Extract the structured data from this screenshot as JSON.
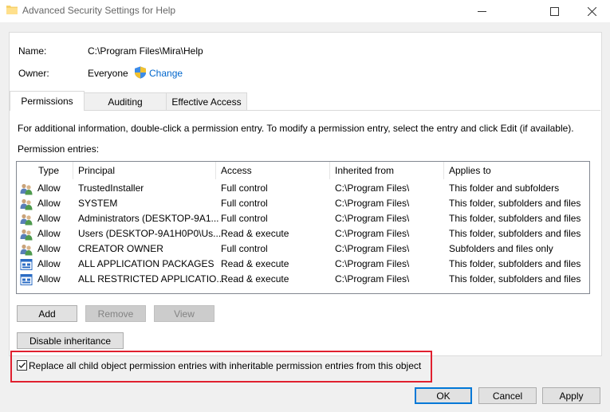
{
  "window": {
    "title": "Advanced Security Settings for Help"
  },
  "details": {
    "name_label": "Name:",
    "name_value": "C:\\Program Files\\Mira\\Help",
    "owner_label": "Owner:",
    "owner_value": "Everyone",
    "change_link": "Change"
  },
  "tabs": [
    {
      "label": "Permissions",
      "active": true
    },
    {
      "label": "Auditing",
      "active": false
    },
    {
      "label": "Effective Access",
      "active": false
    }
  ],
  "info_text": "For additional information, double-click a permission entry. To modify a permission entry, select the entry and click Edit (if available).",
  "entries_label": "Permission entries:",
  "table": {
    "columns": [
      "Type",
      "Principal",
      "Access",
      "Inherited from",
      "Applies to"
    ],
    "rows": [
      {
        "icon": "users-icon",
        "type": "Allow",
        "principal": "TrustedInstaller",
        "access": "Full control",
        "inherited": "C:\\Program Files\\",
        "applies": "This folder and subfolders"
      },
      {
        "icon": "users-icon",
        "type": "Allow",
        "principal": "SYSTEM",
        "access": "Full control",
        "inherited": "C:\\Program Files\\",
        "applies": "This folder, subfolders and files"
      },
      {
        "icon": "users-icon",
        "type": "Allow",
        "principal": "Administrators (DESKTOP-9A1...",
        "access": "Full control",
        "inherited": "C:\\Program Files\\",
        "applies": "This folder, subfolders and files"
      },
      {
        "icon": "users-icon",
        "type": "Allow",
        "principal": "Users (DESKTOP-9A1H0P0\\Us...",
        "access": "Read & execute",
        "inherited": "C:\\Program Files\\",
        "applies": "This folder, subfolders and files"
      },
      {
        "icon": "users-icon",
        "type": "Allow",
        "principal": "CREATOR OWNER",
        "access": "Full control",
        "inherited": "C:\\Program Files\\",
        "applies": "Subfolders and files only"
      },
      {
        "icon": "package-icon",
        "type": "Allow",
        "principal": "ALL APPLICATION PACKAGES",
        "access": "Read & execute",
        "inherited": "C:\\Program Files\\",
        "applies": "This folder, subfolders and files"
      },
      {
        "icon": "package-icon",
        "type": "Allow",
        "principal": "ALL RESTRICTED APPLICATIO...",
        "access": "Read & execute",
        "inherited": "C:\\Program Files\\",
        "applies": "This folder, subfolders and files"
      }
    ]
  },
  "buttons": {
    "add": "Add",
    "remove": "Remove",
    "view": "View",
    "disable_inheritance": "Disable inheritance",
    "ok": "OK",
    "cancel": "Cancel",
    "apply": "Apply"
  },
  "replace_checkbox": {
    "label": "Replace all child object permission entries with inheritable permission entries from this object",
    "checked": true
  },
  "colors": {
    "highlight": "#e0202f",
    "link": "#0066cc",
    "default_button": "#0078d7"
  }
}
